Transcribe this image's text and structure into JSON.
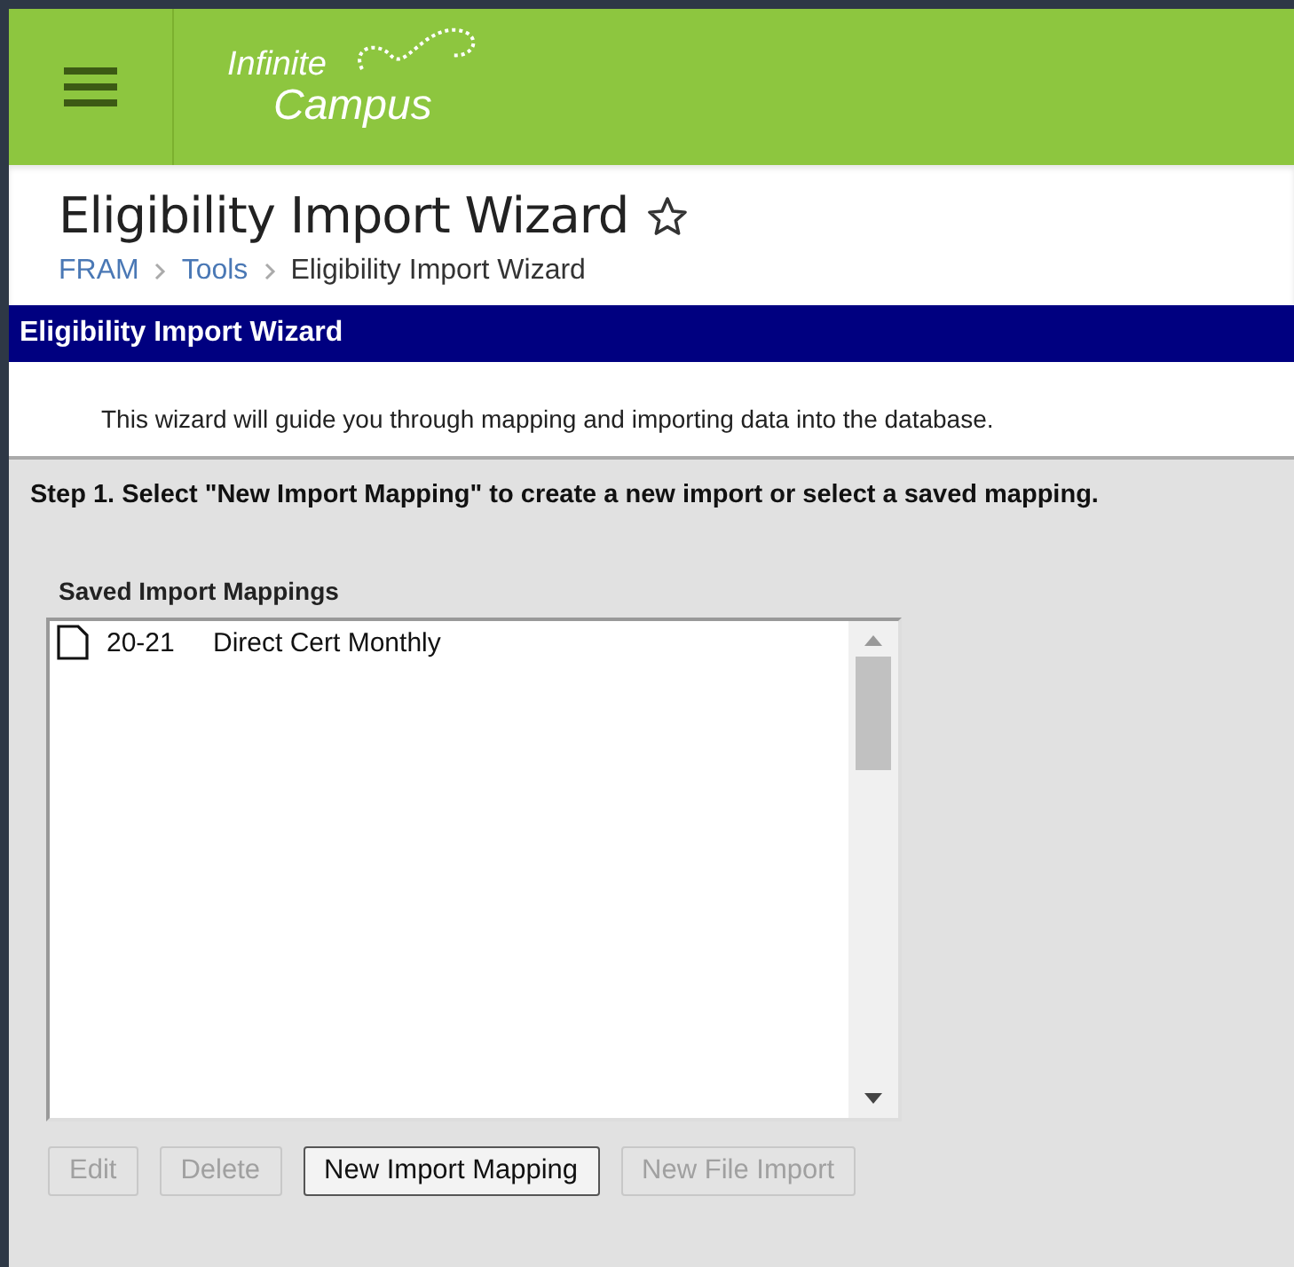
{
  "header": {
    "logo_top": "Infinite",
    "logo_bottom": "Campus"
  },
  "page": {
    "title": "Eligibility Import Wizard",
    "favorite": false,
    "breadcrumb": [
      {
        "label": "FRAM",
        "kind": "link"
      },
      {
        "label": "Tools",
        "kind": "link"
      },
      {
        "label": "Eligibility Import Wizard",
        "kind": "current"
      }
    ]
  },
  "panel": {
    "title": "Eligibility Import Wizard",
    "intro": "This wizard will guide you through mapping and importing data into the database.",
    "step": "Step 1. Select \"New Import Mapping\" to create a new import or select a saved mapping."
  },
  "mappings": {
    "label": "Saved Import Mappings",
    "items": [
      {
        "year": "20-21",
        "name": "Direct Cert Monthly",
        "selected": false
      }
    ]
  },
  "buttons": [
    {
      "label": "Edit",
      "disabled": true
    },
    {
      "label": "Delete",
      "disabled": true
    },
    {
      "label": "New Import Mapping",
      "disabled": false
    },
    {
      "label": "New File Import",
      "disabled": true
    }
  ]
}
